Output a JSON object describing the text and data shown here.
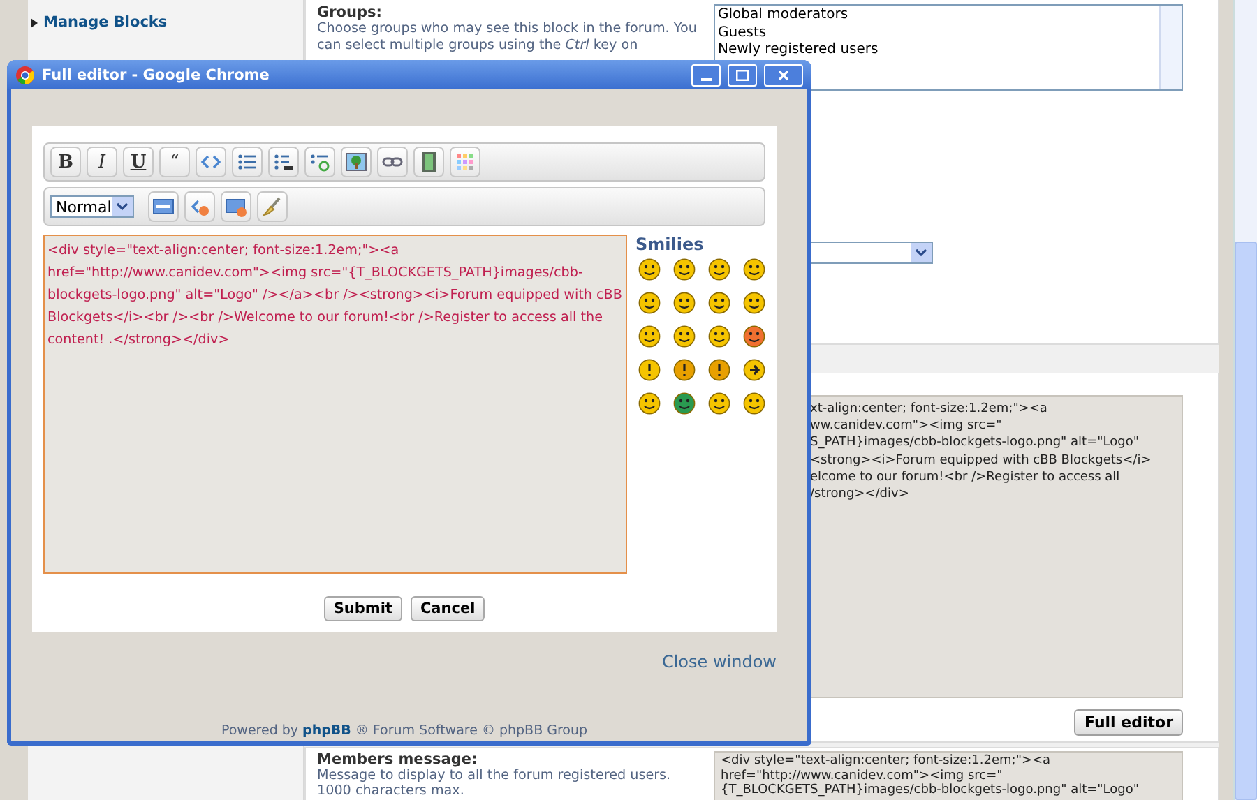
{
  "sidebar": {
    "items": [
      {
        "label": "Manage Blocks",
        "selected": true
      }
    ]
  },
  "groups_setting": {
    "label": "Groups:",
    "description": "Choose groups who may see this block in the forum. You can select multiple groups using the *Ctrl* key on",
    "options": [
      {
        "label": "Global moderators",
        "selected": false
      },
      {
        "label": "Guests",
        "selected": false
      },
      {
        "label": "Newly registered users",
        "selected": false
      }
    ]
  },
  "content_field": {
    "lines": [
      "xt-align:center; font-size:1.2em;\"><a",
      "ww.canidev.com\"><img src=\"",
      "S_PATH}images/cbb-blockgets-logo.png\" alt=\"Logo\"",
      "<strong><i>Forum equipped with cBB Blockgets</i>",
      "elcome to our forum!<br />Register to access all",
      "/strong></div>"
    ],
    "button": "Full editor"
  },
  "members_message": {
    "label": "Members message:",
    "description": "Message to display to all the forum registered users. 1000 characters max.",
    "lines": [
      "<div style=\"text-align:center; font-size:1.2em;\"><a",
      "href=\"http://www.canidev.com\"><img src=\"",
      "{T_BLOCKGETS_PATH}images/cbb-blockgets-logo.png\" alt=\"Logo\""
    ]
  },
  "popup": {
    "title": "Full editor - Google Chrome",
    "toolbar_1": [
      {
        "kind": "text",
        "label": "B"
      },
      {
        "kind": "text",
        "label": "I"
      },
      {
        "kind": "text",
        "label": "U"
      },
      {
        "kind": "text",
        "label": "“"
      },
      {
        "kind": "icon"
      },
      {
        "kind": "icon"
      },
      {
        "kind": "icon"
      },
      {
        "kind": "icon"
      },
      {
        "kind": "icon"
      },
      {
        "kind": "icon"
      },
      {
        "kind": "icon"
      },
      {
        "kind": "icon"
      }
    ],
    "toolbar_2": [
      {
        "kind": "select",
        "label": "Normal"
      },
      {
        "kind": "icon"
      },
      {
        "kind": "icon"
      },
      {
        "kind": "icon"
      },
      {
        "kind": "icon"
      }
    ],
    "editor_text": "<div style=\"text-align:center; font-size:1.2em;\"><a href=\"http://www.canidev.com\"><img src=\"{T_BLOCKGETS_PATH}images/cbb-blockgets-logo.png\" alt=\"Logo\" /></a><br /><strong><i>Forum equipped with cBB Blockgets</i><br /><br />Welcome to our forum!<br />Register to access all the content! .</strong></div>",
    "smilies_title": "Smilies",
    "buttons": [
      "Submit",
      "Cancel"
    ],
    "close_link": "Close window",
    "footer": {
      "before": "Powered by",
      "link": "phpBB",
      "after": "® Forum Software © phpBB Group"
    }
  }
}
